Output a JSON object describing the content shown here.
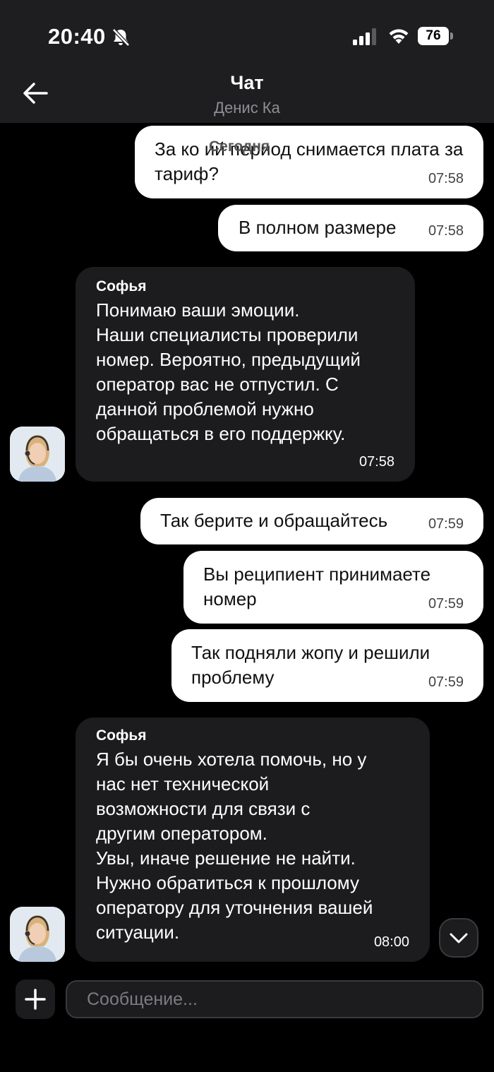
{
  "status": {
    "time": "20:40",
    "battery": "76"
  },
  "header": {
    "title": "Чат",
    "subtitle": "Денис Ка"
  },
  "date_divider": "Сегодня",
  "messages": [
    {
      "dir": "out",
      "text": "За ко   ий период снимается плата за\nтариф?",
      "time": "07:58"
    },
    {
      "dir": "out",
      "text": "В полном размере",
      "time": "07:58"
    },
    {
      "dir": "in",
      "sender": "Софья",
      "text": "Понимаю ваши эмоции.\nНаши специалисты проверили\nномер. Вероятно, предыдущий\nоператор вас не отпустил. С\nданной проблемой нужно\nобращаться в его поддержку.",
      "time": "07:58"
    },
    {
      "dir": "out",
      "text": "Так берите и обращайтесь",
      "time": "07:59"
    },
    {
      "dir": "out",
      "text": "Вы реципиент принимаете\nномер",
      "time": "07:59"
    },
    {
      "dir": "out",
      "text": "Так подняли жопу и решили\nпроблему",
      "time": "07:59"
    },
    {
      "dir": "in",
      "sender": "Софья",
      "text": "Я бы очень хотела помочь, но у\nнас нет технической\nвозможности для связи с\nдругим оператором.\nУвы, иначе решение не найти.\nНужно обратиться к прошлому\nоператору для уточнения вашей\nситуации.",
      "time": "08:00"
    }
  ],
  "composer": {
    "placeholder": "Сообщение..."
  },
  "icons": {
    "back": "arrow-left-icon",
    "mute": "bell-slash-icon",
    "signal": "cellular-signal-icon",
    "wifi": "wifi-icon",
    "scroll": "chevron-down-icon",
    "attach": "plus-icon"
  },
  "colors": {
    "background": "#000000",
    "outgoing_bubble": "#ffffff",
    "incoming_bubble": "#1c1c1e",
    "header": "#1e1e20"
  }
}
